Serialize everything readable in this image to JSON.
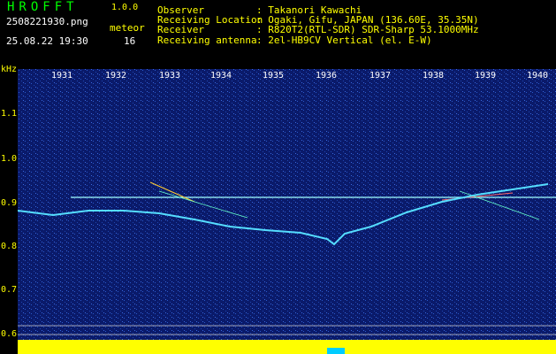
{
  "header": {
    "app_title": "HROFFT",
    "version": "1.0.0",
    "filename": "2508221930.png",
    "meteor_label": "meteor",
    "datetime": "25.08.22 19:30",
    "meteor_count": "16",
    "info": [
      {
        "key": "Observer",
        "value": ": Takanori Kawachi"
      },
      {
        "key": "Receiving Location",
        "value": ": Ogaki, Gifu, JAPAN (136.60E, 35.35N)"
      },
      {
        "key": "Receiver",
        "value": ": R820T2(RTL-SDR) SDR-Sharp 53.1000MHz"
      },
      {
        "key": "Receiving antenna",
        "value": ": 2el-HB9CV Vertical (el. E-W)"
      }
    ]
  },
  "spectrogram": {
    "y_unit": "kHz",
    "y_ticks": [
      "1.1",
      "1.0",
      "0.9",
      "0.8",
      "0.7",
      "0.6"
    ],
    "x_ticks": [
      "1931",
      "1932",
      "1933",
      "1934",
      "1935",
      "1936",
      "1937",
      "1938",
      "1939",
      "1940"
    ],
    "colors": {
      "background": "#0a1a6a",
      "speckle": "#2a5acc",
      "text_yellow": "#ffff00",
      "text_green": "#00ff00"
    }
  }
}
